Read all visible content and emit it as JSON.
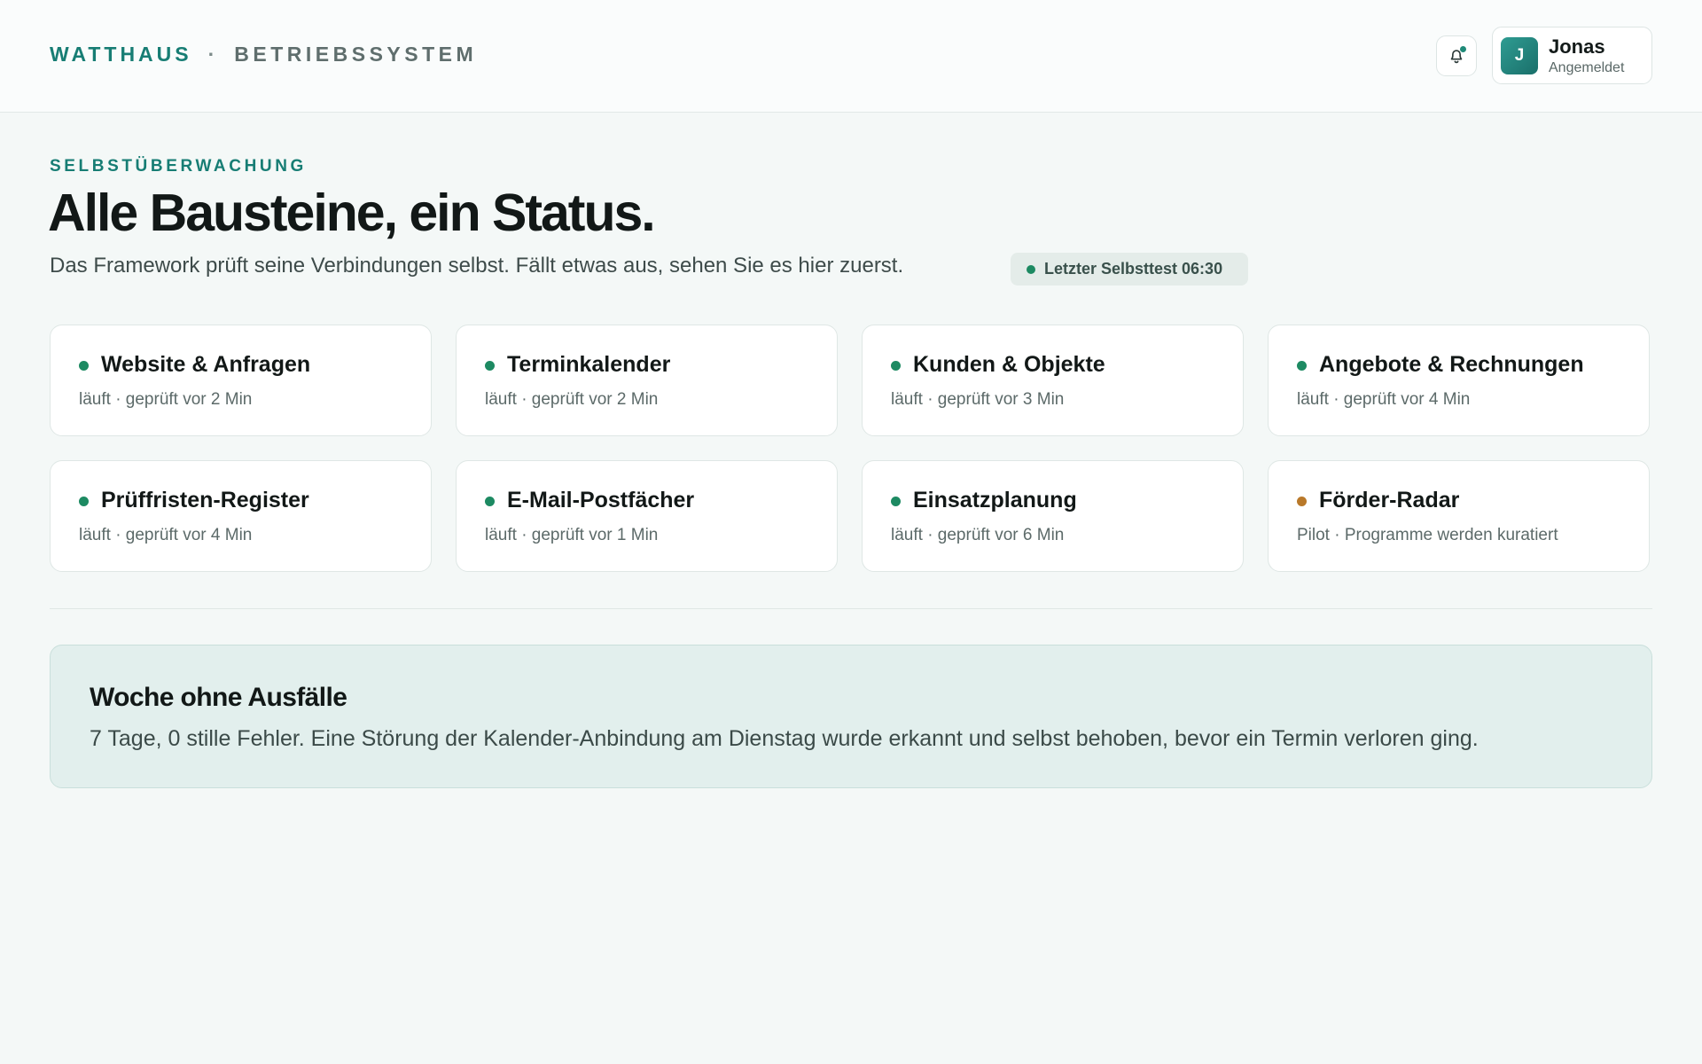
{
  "header": {
    "brand_name": "WATTHAUS",
    "brand_separator": "·",
    "brand_system": "BETRIEBSSYSTEM",
    "user": {
      "initial": "J",
      "name": "Jonas",
      "status": "Angemeldet"
    },
    "notification_icon": "bell-icon"
  },
  "hero": {
    "eyebrow": "SELBSTÜBERWACHUNG",
    "title": "Alle Bausteine, ein Status.",
    "subtitle": "Das Framework prüft seine Verbindungen selbst. Fällt etwas aus, sehen Sie es hier zuerst.",
    "last_check": "Letzter Selbsttest 06:30"
  },
  "modules": [
    {
      "name": "Website & Anfragen",
      "meta": "läuft · geprüft vor 2 Min",
      "state": "ok"
    },
    {
      "name": "Terminkalender",
      "meta": "läuft · geprüft vor 2 Min",
      "state": "ok"
    },
    {
      "name": "Kunden & Objekte",
      "meta": "läuft · geprüft vor 3 Min",
      "state": "ok"
    },
    {
      "name": "Angebote & Rechnungen",
      "meta": "läuft · geprüft vor 4 Min",
      "state": "ok"
    },
    {
      "name": "Prüffristen-Register",
      "meta": "läuft · geprüft vor 4 Min",
      "state": "ok"
    },
    {
      "name": "E-Mail-Postfächer",
      "meta": "läuft · geprüft vor 1 Min",
      "state": "ok"
    },
    {
      "name": "Einsatzplanung",
      "meta": "läuft · geprüft vor 6 Min",
      "state": "ok"
    },
    {
      "name": "Förder-Radar",
      "meta": "Pilot · Programme werden kuratiert",
      "state": "pilot"
    }
  ],
  "summary": {
    "title": "Woche ohne Ausfälle",
    "text": "7 Tage, 0 stille Fehler. Eine Störung der Kalender-Anbindung am Dienstag wurde erkannt und selbst behoben, bevor ein Termin verloren ging."
  },
  "colors": {
    "accent": "#177d74",
    "status_ok": "#1d8a62",
    "status_pilot": "#b9792a",
    "page_bg": "#f4f8f7",
    "summary_bg": "#e2efed"
  }
}
